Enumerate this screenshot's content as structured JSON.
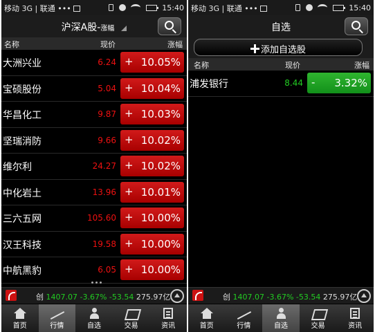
{
  "status_bar": {
    "carrier": "移动 3G | 联通 •••",
    "time": "15:40"
  },
  "left": {
    "title": "沪深A股-",
    "title_sub": "涨幅",
    "columns": {
      "name": "名称",
      "price": "现价",
      "change": "涨幅"
    },
    "rows": [
      {
        "name": "大洲兴业",
        "price": "6.24",
        "sign": "+",
        "change": "10.05%"
      },
      {
        "name": "宝硕股份",
        "price": "5.04",
        "sign": "+",
        "change": "10.04%"
      },
      {
        "name": "华昌化工",
        "price": "9.87",
        "sign": "+",
        "change": "10.03%"
      },
      {
        "name": "坚瑞消防",
        "price": "9.66",
        "sign": "+",
        "change": "10.02%"
      },
      {
        "name": "维尔利",
        "price": "24.27",
        "sign": "+",
        "change": "10.02%"
      },
      {
        "name": "中化岩土",
        "price": "13.96",
        "sign": "+",
        "change": "10.01%"
      },
      {
        "name": "三六五网",
        "price": "105.60",
        "sign": "+",
        "change": "10.00%"
      },
      {
        "name": "汉王科技",
        "price": "19.58",
        "sign": "+",
        "change": "10.00%"
      },
      {
        "name": "中航黑豹",
        "price": "6.05",
        "sign": "+",
        "change": "10.00%"
      }
    ]
  },
  "right": {
    "title": "自选",
    "add_button": "添加自选股",
    "columns": {
      "name": "名称",
      "price": "现价",
      "change": "涨幅"
    },
    "rows": [
      {
        "name": "浦发银行",
        "price": "8.44",
        "sign": "-",
        "change": "3.32%"
      }
    ]
  },
  "ticker": {
    "label": "创",
    "index": "1407.07",
    "pct": "-3.67%",
    "delta": "-53.54",
    "amount": "275.97亿"
  },
  "tabs": [
    "首页",
    "行情",
    "自选",
    "交易",
    "资讯"
  ],
  "colors": {
    "up": "#cc1111",
    "down": "#22aa22",
    "background": "#000000"
  }
}
